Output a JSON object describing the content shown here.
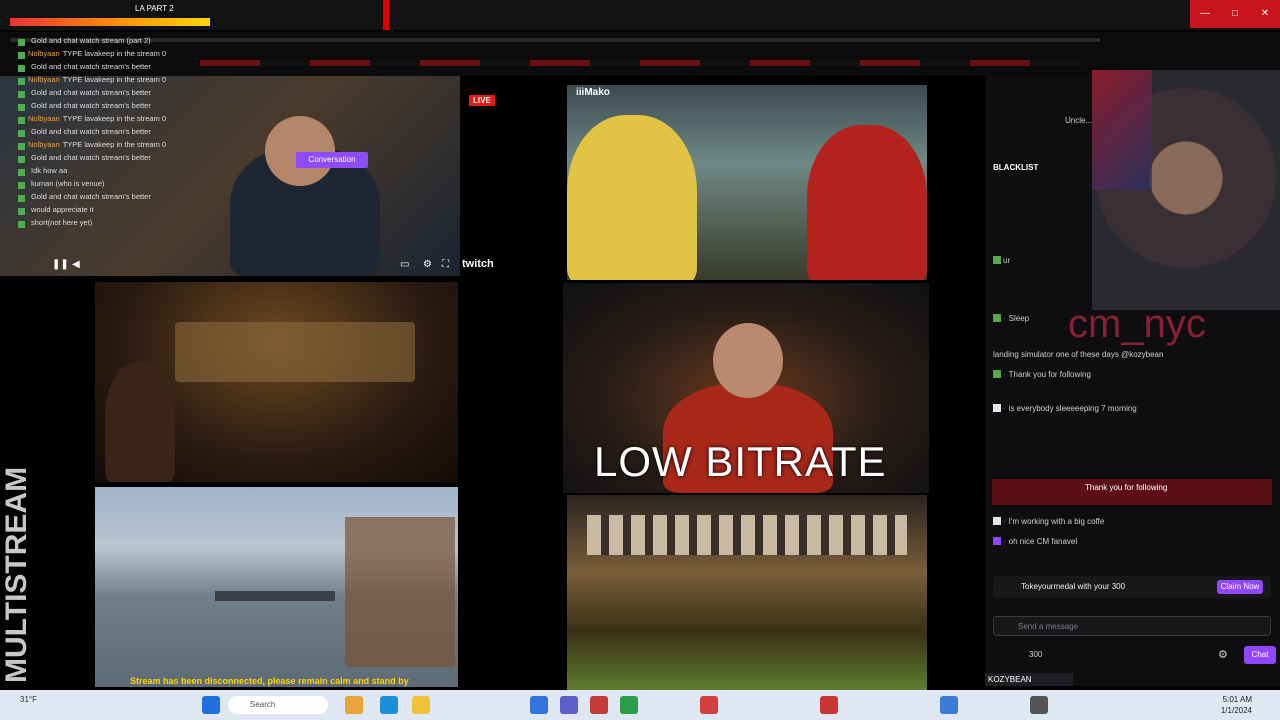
{
  "window": {
    "title": "LA PART 2",
    "close": "✕",
    "max": "□",
    "min": "—"
  },
  "overlay_chat": {
    "messages": [
      {
        "user": "",
        "text": "Gold and chat watch stream (part 2)"
      },
      {
        "user": "Nolbyaan",
        "text": "TYPE lavakeep in the stream 0"
      },
      {
        "user": "",
        "text": "Gold and chat watch stream's better"
      },
      {
        "user": "Nolbyaan",
        "text": "TYPE lavakeep in the stream 0"
      },
      {
        "user": "",
        "text": "Gold and chat watch stream's better"
      },
      {
        "user": "",
        "text": "Gold and chat watch stream's better"
      },
      {
        "user": "Nolbyaan",
        "text": "TYPE lavakeep in the stream 0"
      },
      {
        "user": "",
        "text": "Gold and chat watch stream's better"
      },
      {
        "user": "Nolbyaan",
        "text": "TYPE lavakeep in the stream 0"
      },
      {
        "user": "",
        "text": "Gold and chat watch stream's better"
      },
      {
        "user": "",
        "text": "Idk how aa"
      },
      {
        "user": "",
        "text": "kuman (who is venue)"
      },
      {
        "user": "",
        "text": "Gold and chat watch stream's better"
      },
      {
        "user": "",
        "text": "would appreciate it"
      },
      {
        "user": "",
        "text": "short(not here yet)"
      }
    ]
  },
  "tile1": {
    "live": "LIVE",
    "convo_button": "Conversation",
    "twitch": "twitch"
  },
  "tile4": {
    "watermark": "iiiMako"
  },
  "tile5": {
    "overlay": "LOW BITRATE"
  },
  "tile3": {
    "caption": "Stream has been disconnected, please remain calm and stand by"
  },
  "sidebar_label": "MULTISTREAM",
  "webcam": {
    "overlay": "cm_nyc"
  },
  "chat": {
    "header": "BLACKLIST",
    "messages": [
      {
        "user": "",
        "text": "Uncle..."
      },
      {
        "user": "",
        "text": "ur"
      },
      {
        "user": "",
        "text": "Sleep"
      },
      {
        "user": "",
        "text": "landing simulator one of these days @kozybean"
      },
      {
        "user": "",
        "text": "Thank you for following"
      },
      {
        "user": "",
        "text": "is everybody sleeeeeping 7 morning"
      },
      {
        "user": "",
        "text": "Thank you for following"
      },
      {
        "user": "",
        "text": "I'm working with a big coffe"
      },
      {
        "user": "",
        "text": "oh nice CM fanavel"
      }
    ],
    "channel_bar_text": "Tokeyourmedal with your 300",
    "channel_bar_button": "Claim Now",
    "input_placeholder": "Send a message",
    "points": "300",
    "chat_button": "Chat",
    "name_tag": "KOZYBEAN"
  },
  "taskbar": {
    "search": "Search",
    "weather": "31°F",
    "time": "5:01 AM",
    "date": "1/1/2024"
  }
}
